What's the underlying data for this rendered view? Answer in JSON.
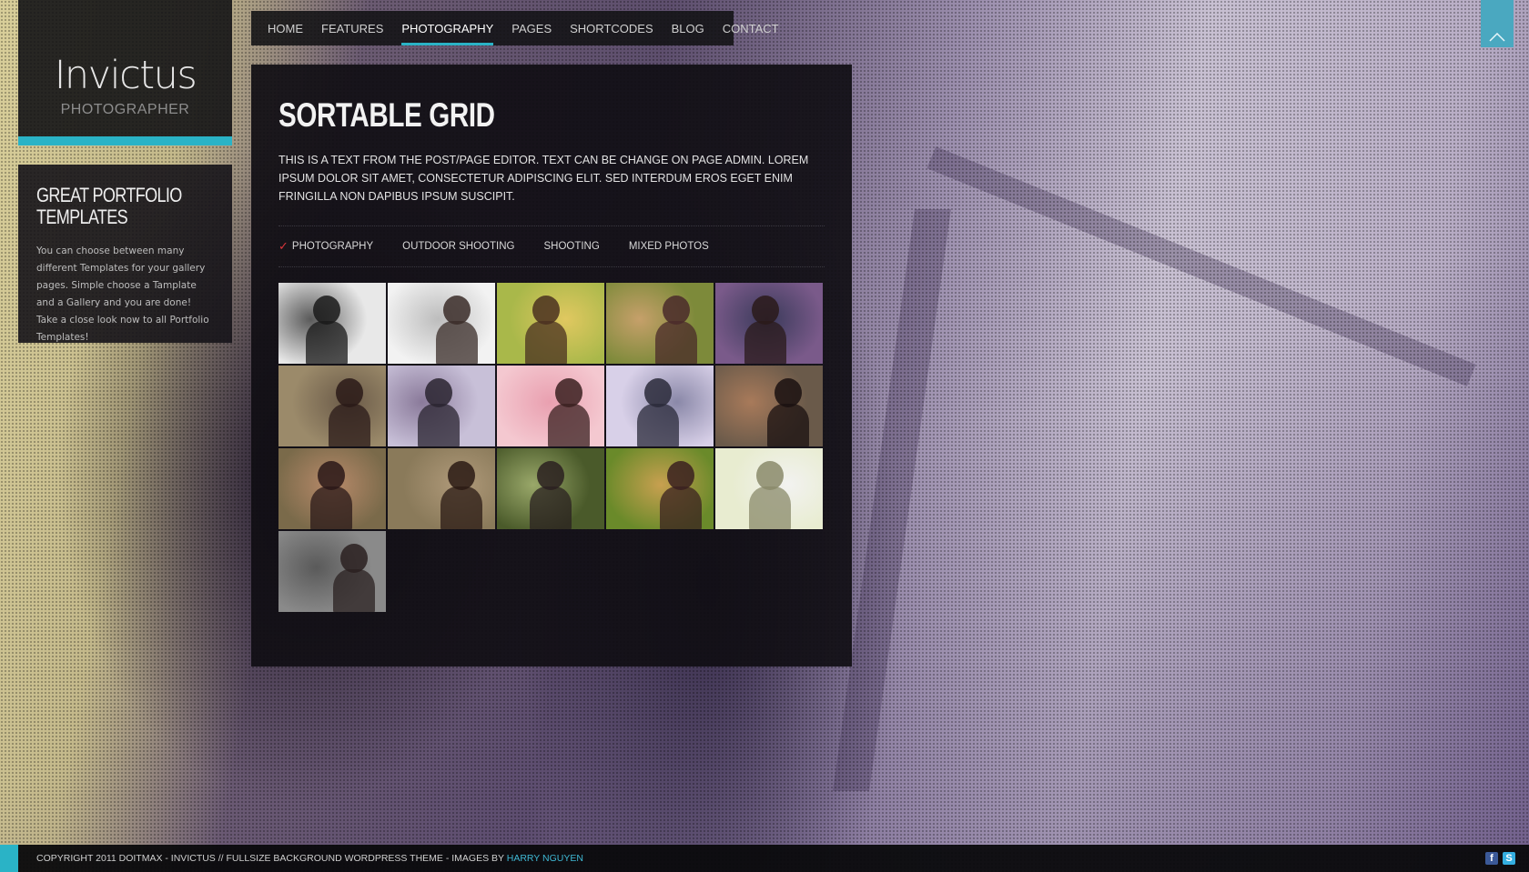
{
  "logo": {
    "title": "Invictus",
    "subtitle": "PHOTOGRAPHER"
  },
  "widget": {
    "title": "GREAT PORTFOLIO TEMPLATES",
    "text": "You can choose between many different Templates for your gallery pages. Simple choose a Tamplate and a Gallery and you are done! Take a close look now to all Portfolio Templates!"
  },
  "nav": {
    "items": [
      {
        "label": "HOME"
      },
      {
        "label": "FEATURES"
      },
      {
        "label": "PHOTOGRAPHY"
      },
      {
        "label": "PAGES"
      },
      {
        "label": "SHORTCODES"
      },
      {
        "label": "BLOG"
      },
      {
        "label": "CONTACT"
      }
    ],
    "active": "PHOTOGRAPHY"
  },
  "main": {
    "title": "SORTABLE GRID",
    "description": "THIS IS A TEXT FROM THE POST/PAGE EDITOR. TEXT CAN BE CHANGE ON PAGE ADMIN. LOREM IPSUM DOLOR SIT AMET, CONSECTETUR ADIPISCING ELIT. SED INTERDUM EROS EGET ENIM FRINGILLA NON DAPIBUS IPSUM SUSCIPIT.",
    "filters": [
      {
        "label": "PHOTOGRAPHY",
        "selected": true
      },
      {
        "label": "OUTDOOR SHOOTING",
        "selected": false
      },
      {
        "label": "SHOOTING",
        "selected": false
      },
      {
        "label": "MIXED PHOTOS",
        "selected": false
      }
    ],
    "gallery_count": 16
  },
  "footer": {
    "text": "COPYRIGHT 2011 DOITMAX - INVICTUS // FULLSIZE BACKGROUND WORDPRESS THEME - IMAGES BY ",
    "link": "HARRY NGUYEN",
    "social": [
      {
        "icon": "facebook-icon",
        "glyph": "f"
      },
      {
        "icon": "skype-icon",
        "glyph": "S"
      }
    ]
  },
  "colors": {
    "accent": "#2ab3c6",
    "panel": "#100e14",
    "check": "#d8353b",
    "link": "#3fb8d4"
  }
}
